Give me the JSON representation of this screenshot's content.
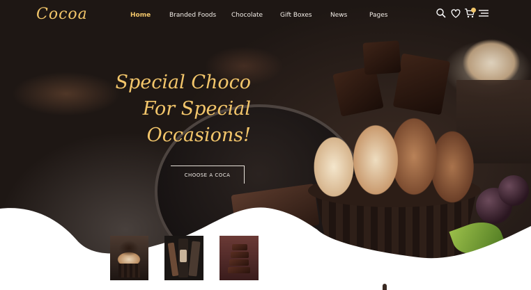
{
  "brand": {
    "logo_text": "Cocoa",
    "accent_color": "#f2c66a"
  },
  "nav": {
    "items": [
      {
        "label": "Home",
        "active": true
      },
      {
        "label": "Branded Foods",
        "active": false
      },
      {
        "label": "Chocolate",
        "active": false
      },
      {
        "label": "Gift Boxes",
        "active": false
      },
      {
        "label": "News",
        "active": false
      },
      {
        "label": "Pages",
        "active": false
      }
    ],
    "icons": [
      "search-icon",
      "heart-icon",
      "cart-icon",
      "menu-icon"
    ]
  },
  "hero": {
    "headline_lines": [
      "Special Choco",
      "For Special",
      "Occasions!"
    ],
    "cta_label": "CHOOSE A COCA"
  },
  "thumbnails": [
    "cupcake-thumbnail",
    "chocolate-bars-thumbnail",
    "chocolate-stack-thumbnail"
  ]
}
